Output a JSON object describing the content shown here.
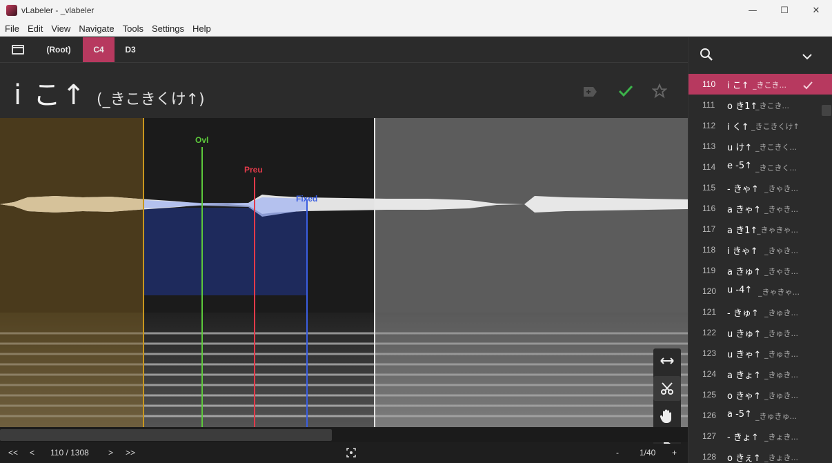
{
  "window": {
    "title": "vLabeler - _vlabeler",
    "minimize": "—",
    "maximize": "☐",
    "close": "✕"
  },
  "menu": [
    "File",
    "Edit",
    "View",
    "Navigate",
    "Tools",
    "Settings",
    "Help"
  ],
  "tabs": {
    "root": "(Root)",
    "active": "C4",
    "other": "D3"
  },
  "entry": {
    "name": "i こ↑",
    "sample": "(_きこきくけ↑)",
    "done": true
  },
  "markers": {
    "ovl": "Ovl",
    "preu": "Preu",
    "fixed": "Fixed"
  },
  "footer": {
    "first": "<<",
    "prev": "<",
    "position": "110 / 1308",
    "next": ">",
    "last": ">>",
    "zoom_out": "-",
    "zoom": "1/40",
    "zoom_in": "+"
  },
  "tools": [
    "cursor-tool",
    "scissors-tool",
    "pan-tool",
    "play-tool"
  ],
  "colors": {
    "accent": "#b7395f",
    "ovl": "#5cc93b",
    "preu": "#e23a4a",
    "fixed": "#3b5ee0",
    "cutoff": "#c8961e"
  },
  "entries": [
    {
      "index": "110",
      "name": "i こ↑",
      "sample": "_きこき..."
    },
    {
      "index": "111",
      "name": "o き1↑",
      "sample": "_きこき..."
    },
    {
      "index": "112",
      "name": "i く↑",
      "sample": "_きこきくけ↑"
    },
    {
      "index": "113",
      "name": "u け↑",
      "sample": "_きこきく..."
    },
    {
      "index": "114",
      "name": "e -5↑",
      "sample": "_きこきく..."
    },
    {
      "index": "115",
      "name": "- きゃ↑",
      "sample": "_きゃき..."
    },
    {
      "index": "116",
      "name": "a きゃ↑",
      "sample": "_きゃき..."
    },
    {
      "index": "117",
      "name": "a き1↑",
      "sample": "_きゃきゃ..."
    },
    {
      "index": "118",
      "name": "i きゃ↑",
      "sample": "_きゃき..."
    },
    {
      "index": "119",
      "name": "a きゅ↑",
      "sample": "_きゃき..."
    },
    {
      "index": "120",
      "name": "u -4↑",
      "sample": "_きゃきゃ..."
    },
    {
      "index": "121",
      "name": "- きゅ↑",
      "sample": "_きゅき..."
    },
    {
      "index": "122",
      "name": "u きゅ↑",
      "sample": "_きゅき..."
    },
    {
      "index": "123",
      "name": "u きゃ↑",
      "sample": "_きゅき..."
    },
    {
      "index": "124",
      "name": "a きょ↑",
      "sample": "_きゅき..."
    },
    {
      "index": "125",
      "name": "o きゃ↑",
      "sample": "_きゅき..."
    },
    {
      "index": "126",
      "name": "a -5↑",
      "sample": "_きゅきゅ..."
    },
    {
      "index": "127",
      "name": "- きょ↑",
      "sample": "_きょき..."
    },
    {
      "index": "128",
      "name": "o きぇ↑",
      "sample": "_きょき..."
    }
  ]
}
